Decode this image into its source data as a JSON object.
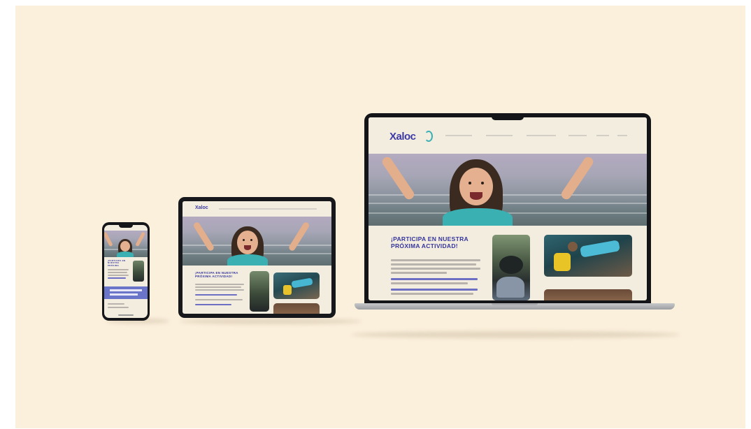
{
  "website": {
    "brand_logo": "Xaloc",
    "nav_items": [
      "",
      "",
      "",
      "",
      "",
      ""
    ],
    "hero_caption": "",
    "headline_line1": "¡PARTICIPA EN NUESTRA",
    "headline_line2": "PRÓXIMA ACTIVIDAD!"
  },
  "devices": [
    "phone",
    "tablet",
    "laptop"
  ],
  "colors": {
    "background": "#fbf0dc",
    "headline": "#34359c",
    "accent": "#3ab0b3",
    "phone_band": "#6a74c8"
  }
}
